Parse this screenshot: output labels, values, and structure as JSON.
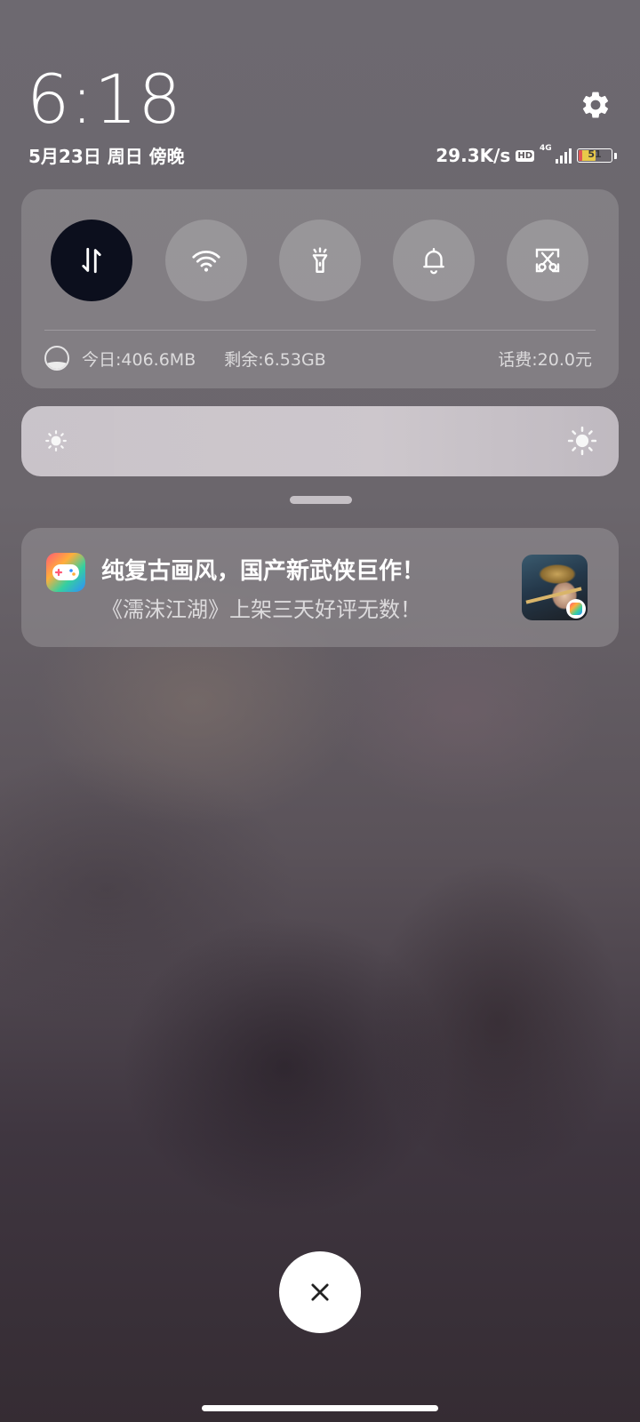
{
  "status": {
    "time": "6:18",
    "date": "5月23日 周日 傍晚",
    "net_speed": "29.3K/s",
    "hd": "HD",
    "network_type": "4G",
    "battery_level": "51"
  },
  "quick_settings": {
    "toggles": [
      {
        "name": "mobile-data",
        "icon": "data-transfer-icon",
        "active": true
      },
      {
        "name": "wifi",
        "icon": "wifi-icon",
        "active": false
      },
      {
        "name": "flashlight",
        "icon": "flashlight-icon",
        "active": false
      },
      {
        "name": "sound",
        "icon": "bell-icon",
        "active": false
      },
      {
        "name": "screenshot",
        "icon": "scissors-icon",
        "active": false
      }
    ],
    "data_today": "今日:406.6MB",
    "data_remaining": "剩余:6.53GB",
    "phone_balance": "话费:20.0元"
  },
  "brightness": {
    "min_icon": "sun-small-icon",
    "max_icon": "sun-large-icon"
  },
  "notification": {
    "title": "纯复古画风，国产新武侠巨作！",
    "body": "《濡沫江湖》上架三天好评无数！",
    "app_icon": "game-center-icon"
  },
  "colors": {
    "active_toggle": "#0c0f1d",
    "panel": "rgba(150,145,150,0.55)",
    "text": "#ffffff"
  }
}
